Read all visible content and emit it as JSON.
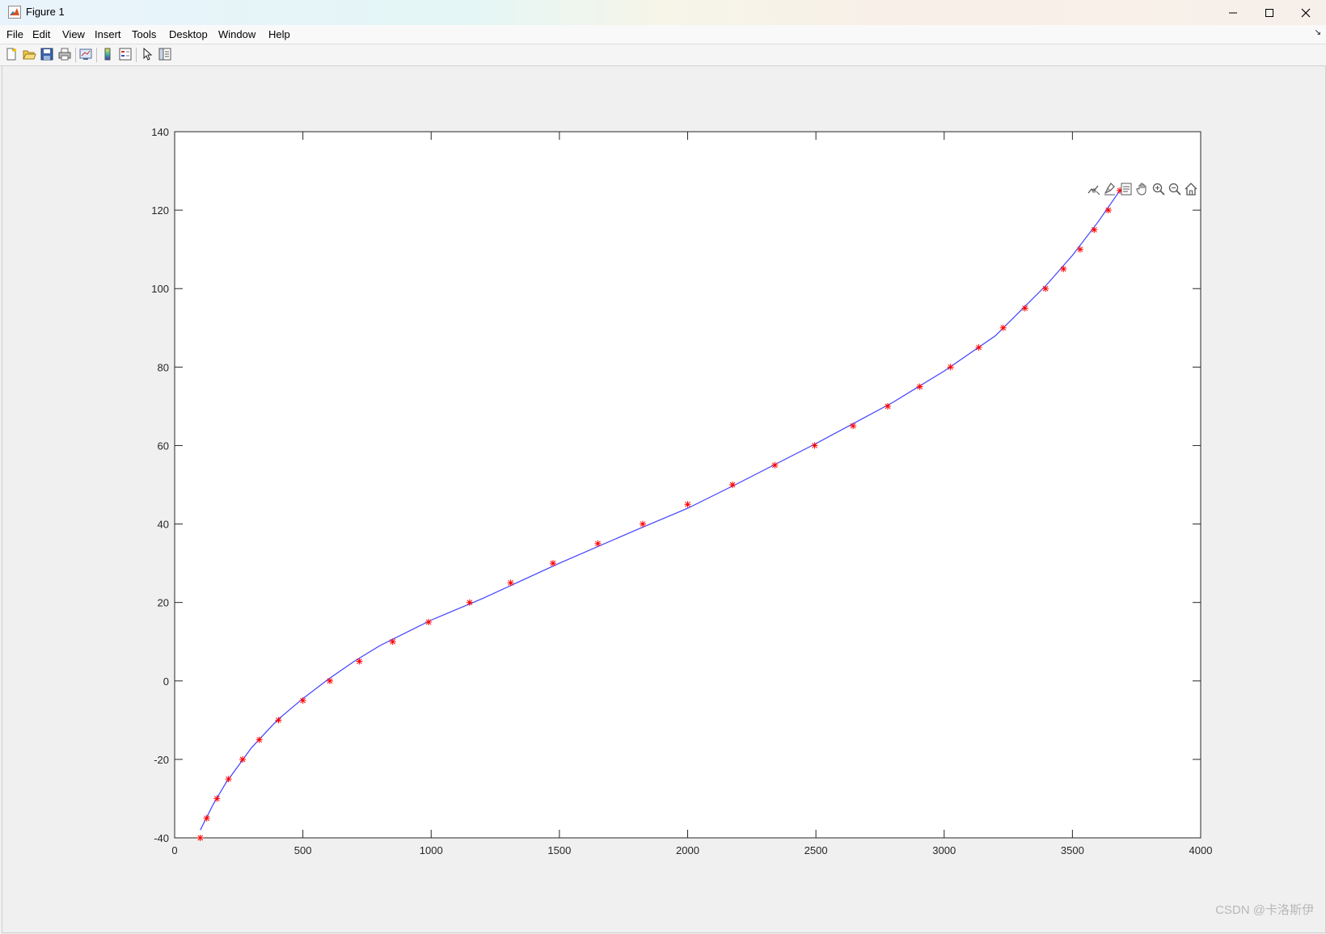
{
  "window": {
    "title": "Figure 1"
  },
  "menu": [
    "File",
    "Edit",
    "View",
    "Insert",
    "Tools",
    "Desktop",
    "Window",
    "Help"
  ],
  "toolbar_icons": [
    "new-figure-icon",
    "open-file-icon",
    "save-icon",
    "print-icon",
    "link-plot-icon",
    "colorbar-icon",
    "legend-icon",
    "edit-plot-icon",
    "property-inspector-icon"
  ],
  "axes_toolbar_icons": [
    "data-tips-icon",
    "brush-icon",
    "restore-view-icon",
    "pan-icon",
    "zoom-in-icon",
    "zoom-out-icon",
    "home-icon"
  ],
  "watermark": "CSDN @卡洛斯伊",
  "colors": {
    "line": "#4040ff",
    "marker": "#ff0000",
    "axis": "#262626",
    "plot_bg": "#ffffff",
    "figure_bg": "#f0f0f0"
  },
  "chart_data": {
    "type": "line",
    "title": "",
    "xlabel": "",
    "ylabel": "",
    "xlim": [
      0,
      4000
    ],
    "ylim": [
      -40,
      140
    ],
    "xticks": [
      0,
      500,
      1000,
      1500,
      2000,
      2500,
      3000,
      3500,
      4000
    ],
    "yticks": [
      -40,
      -20,
      0,
      20,
      40,
      60,
      80,
      100,
      120,
      140
    ],
    "grid": false,
    "legend": "none",
    "series": [
      {
        "style": "red-asterisk-markers",
        "x": [
          100,
          125,
          165,
          210,
          265,
          330,
          405,
          500,
          605,
          720,
          850,
          990,
          1150,
          1310,
          1475,
          1650,
          1825,
          2000,
          2175,
          2340,
          2495,
          2645,
          2780,
          2905,
          3025,
          3135,
          3230,
          3315,
          3395,
          3465,
          3530,
          3585,
          3640,
          3685
        ],
        "y": [
          -40,
          -35,
          -30,
          -25,
          -20,
          -15,
          -10,
          -5,
          0,
          5,
          10,
          15,
          20,
          25,
          30,
          35,
          40,
          45,
          50,
          55,
          60,
          65,
          70,
          75,
          80,
          85,
          90,
          95,
          100,
          105,
          110,
          115,
          120,
          125
        ]
      },
      {
        "style": "blue-fitted-line",
        "x": [
          100,
          150,
          200,
          300,
          400,
          500,
          600,
          700,
          800,
          1000,
          1200,
          1500,
          1800,
          2000,
          2200,
          2500,
          2800,
          3000,
          3200,
          3400,
          3500,
          3600,
          3685
        ],
        "y": [
          -38,
          -31.5,
          -26,
          -17,
          -10,
          -4.5,
          0.5,
          5,
          9,
          15.5,
          21,
          30,
          38.5,
          44,
          50.5,
          60.5,
          71,
          79,
          88,
          101,
          108.5,
          117,
          125
        ]
      }
    ]
  }
}
